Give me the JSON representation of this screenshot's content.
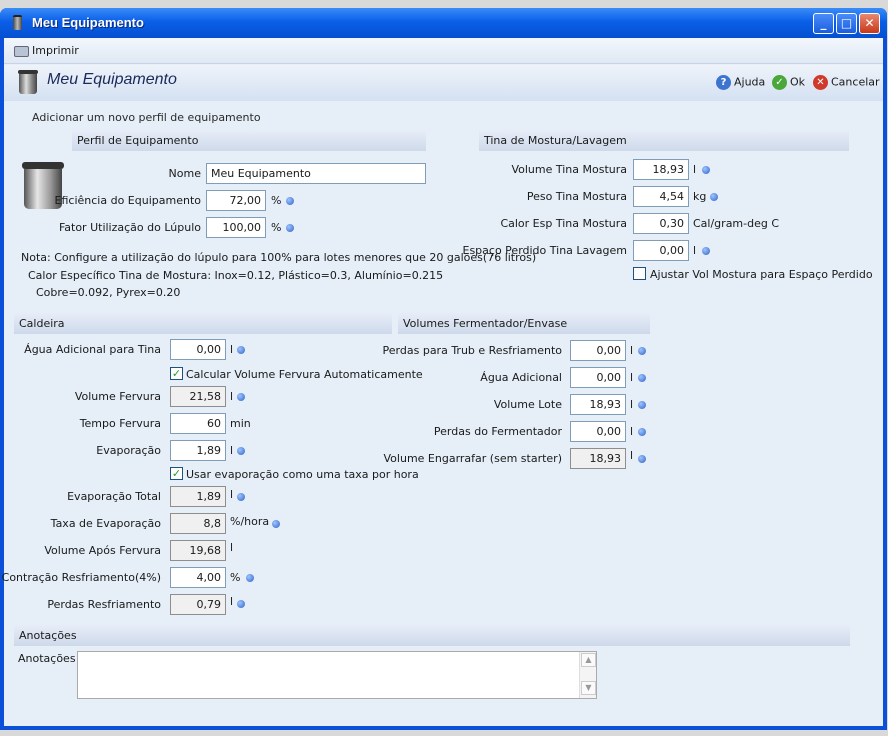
{
  "window": {
    "title": "Meu Equipamento"
  },
  "toolbar": {
    "print_label": "Imprimir"
  },
  "header": {
    "title": "Meu Equipamento",
    "help_label": "Ajuda",
    "ok_label": "Ok",
    "cancel_label": "Cancelar",
    "subtitle": "Adicionar um novo perfil de equipamento"
  },
  "profile": {
    "section": "Perfil de Equipamento",
    "name_label": "Nome",
    "name_value": "Meu Equipamento",
    "efficiency_label": "Eficiência do Equipamento",
    "efficiency_value": "72,00",
    "efficiency_unit": "%",
    "hop_label": "Fator Utilização do Lúpulo",
    "hop_value": "100,00",
    "hop_unit": "%",
    "note1": "Nota: Configure a utilização do lúpulo para 100% para lotes menores que 20 galões(76 litros)",
    "note2": "Calor Específico Tina de Mostura: Inox=0.12, Plástico=0.3, Alumínio=0.215",
    "note3": "Cobre=0.092, Pyrex=0.20"
  },
  "mash": {
    "section": "Tina de Mostura/Lavagem",
    "volume_label": "Volume Tina Mostura",
    "volume_value": "18,93",
    "volume_unit": "l",
    "weight_label": "Peso Tina Mostura",
    "weight_value": "4,54",
    "weight_unit": "kg",
    "heat_label": "Calor Esp Tina Mostura",
    "heat_value": "0,30",
    "heat_unit": "Cal/gram-deg C",
    "deadspace_label": "Espaço Perdido Tina Lavagem",
    "deadspace_value": "0,00",
    "deadspace_unit": "l",
    "adjust_label": "Ajustar Vol Mostura para Espaço Perdido",
    "adjust_checked": false
  },
  "boil": {
    "section": "Caldeira",
    "topup_label": "Água Adicional para Tina",
    "topup_value": "0,00",
    "topup_unit": "l",
    "calc_label": "Calcular Volume Fervura Automaticamente",
    "calc_checked": true,
    "boil_vol_label": "Volume Fervura",
    "boil_vol_value": "21,58",
    "boil_vol_unit": "l",
    "boil_time_label": "Tempo Fervura",
    "boil_time_value": "60",
    "boil_time_unit": "min",
    "evap_label": "Evaporação",
    "evap_value": "1,89",
    "evap_unit": "l",
    "evap_rate_chk_label": "Usar evaporação como uma taxa por hora",
    "evap_rate_checked": true,
    "evap_total_label": "Evaporação Total",
    "evap_total_value": "1,89",
    "evap_total_unit": "l",
    "evap_rate_label": "Taxa de Evaporação",
    "evap_rate_value": "8,8",
    "evap_rate_unit": "%/hora",
    "post_boil_label": "Volume Após Fervura",
    "post_boil_value": "19,68",
    "post_boil_unit": "l",
    "shrink_label": "Contração Resfriamento(4%)",
    "shrink_value": "4,00",
    "shrink_unit": "%",
    "cool_loss_label": "Perdas Resfriamento",
    "cool_loss_value": "0,79",
    "cool_loss_unit": "l"
  },
  "ferm": {
    "section": "Volumes Fermentador/Envase",
    "trub_label": "Perdas para Trub e Resfriamento",
    "trub_value": "0,00",
    "trub_unit": "l",
    "water_label": "Água Adicional",
    "water_value": "0,00",
    "water_unit": "l",
    "batch_label": "Volume Lote",
    "batch_value": "18,93",
    "batch_unit": "l",
    "ferm_loss_label": "Perdas do Fermentador",
    "ferm_loss_value": "0,00",
    "ferm_loss_unit": "l",
    "bottle_label": "Volume Engarrafar (sem starter)",
    "bottle_value": "18,93",
    "bottle_unit": "l"
  },
  "notes": {
    "section": "Anotações",
    "label": "Anotações",
    "value": ""
  },
  "colors": {
    "title_bar": "#0a5fe8",
    "client_bg": "#e6eff8",
    "info_dot": "#2e64c8"
  }
}
